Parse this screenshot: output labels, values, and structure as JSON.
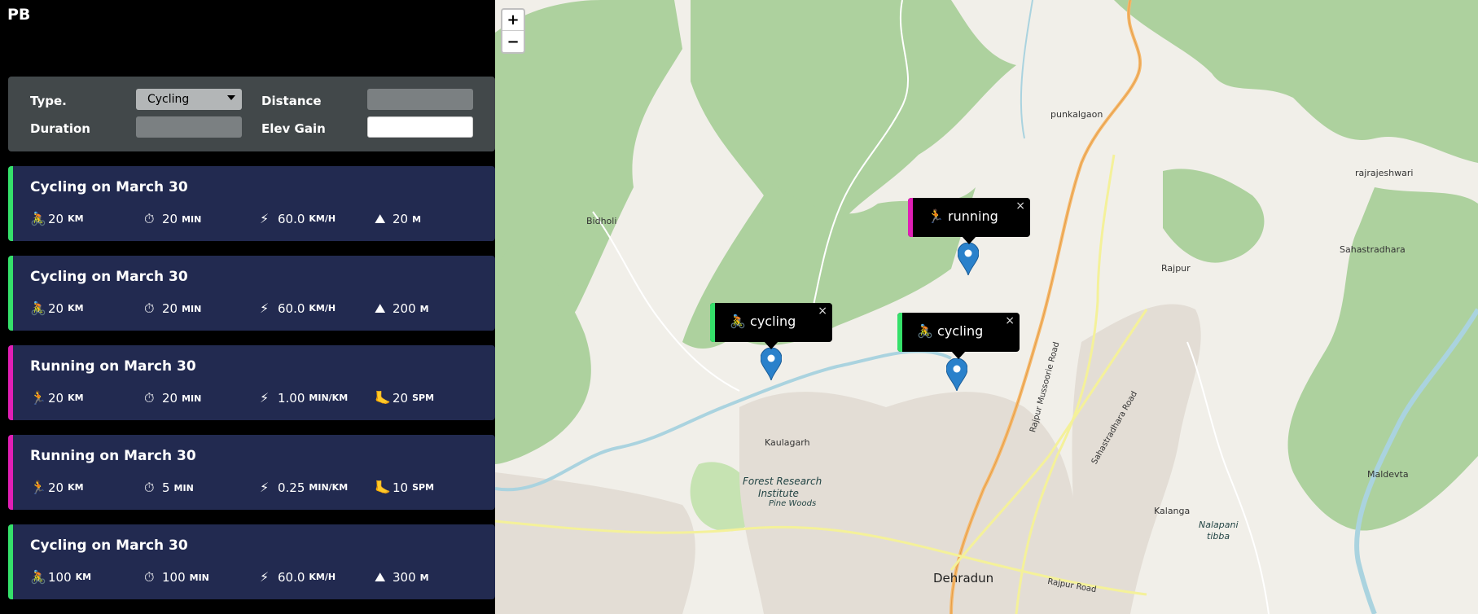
{
  "app": {
    "logo": "PB"
  },
  "form": {
    "type_label": "Type.",
    "type_value": "Cycling",
    "distance_label": "Distance",
    "duration_label": "Duration",
    "elev_label": "Elev Gain"
  },
  "workouts": [
    {
      "title": "Cycling on March 30",
      "kind": "cycling",
      "color": "#35e06a",
      "s1": "20",
      "s1u": "KM",
      "s2": "20",
      "s2u": "MIN",
      "s3": "60.0",
      "s3u": "KM/H",
      "s4": "20",
      "s4u": "M"
    },
    {
      "title": "Cycling on March 30",
      "kind": "cycling",
      "color": "#35e06a",
      "s1": "20",
      "s1u": "KM",
      "s2": "20",
      "s2u": "MIN",
      "s3": "60.0",
      "s3u": "KM/H",
      "s4": "200",
      "s4u": "M"
    },
    {
      "title": "Running on March 30",
      "kind": "running",
      "color": "#e01fb5",
      "s1": "20",
      "s1u": "KM",
      "s2": "20",
      "s2u": "MIN",
      "s3": "1.00",
      "s3u": "MIN/KM",
      "s4": "20",
      "s4u": "SPM"
    },
    {
      "title": "Running on March 30",
      "kind": "running",
      "color": "#e01fb5",
      "s1": "20",
      "s1u": "KM",
      "s2": "5",
      "s2u": "MIN",
      "s3": "0.25",
      "s3u": "MIN/KM",
      "s4": "10",
      "s4u": "SPM"
    },
    {
      "title": "Cycling on March 30",
      "kind": "cycling",
      "color": "#35e06a",
      "s1": "100",
      "s1u": "KM",
      "s2": "100",
      "s2u": "MIN",
      "s3": "60.0",
      "s3u": "KM/H",
      "s4": "300",
      "s4u": "M"
    }
  ],
  "icons": {
    "cycling": "🚴",
    "running": "🏃",
    "timer": "⏱",
    "speed": "⚡",
    "elev": "⛰",
    "cadence": "🦶"
  },
  "map": {
    "zoom_in": "+",
    "zoom_out": "−",
    "popups": [
      {
        "text": "running",
        "icon": "🏃",
        "color": "#e01fb5",
        "close": "×"
      },
      {
        "text": "cycling",
        "icon": "🚴",
        "color": "#35e06a",
        "close": "×"
      },
      {
        "text": "cycling",
        "icon": "🚴",
        "color": "#35e06a",
        "close": "×"
      }
    ],
    "labels": {
      "punkalgaon": "punkalgaon",
      "rajrajeshwari": "rajrajeshwari",
      "bidholi": "Bidholi",
      "sahastradhara": "Sahastradhara",
      "rajpur": "Rajpur",
      "kaulagarh": "Kaulagarh",
      "fri1": "Forest Research",
      "fri2": "Institute",
      "pinewoods": "Pine Woods",
      "maldevta": "Maldevta",
      "kalanga": "Kalanga",
      "nalapani1": "Nalapani",
      "nalapani2": "tibba",
      "dehradun": "Dehradun",
      "rajpurroad": "Rajpur Road",
      "sahastradhararoad": "Sahastradhara Road",
      "mussoorieroad": "Rajpur Mussoorie Road"
    }
  }
}
